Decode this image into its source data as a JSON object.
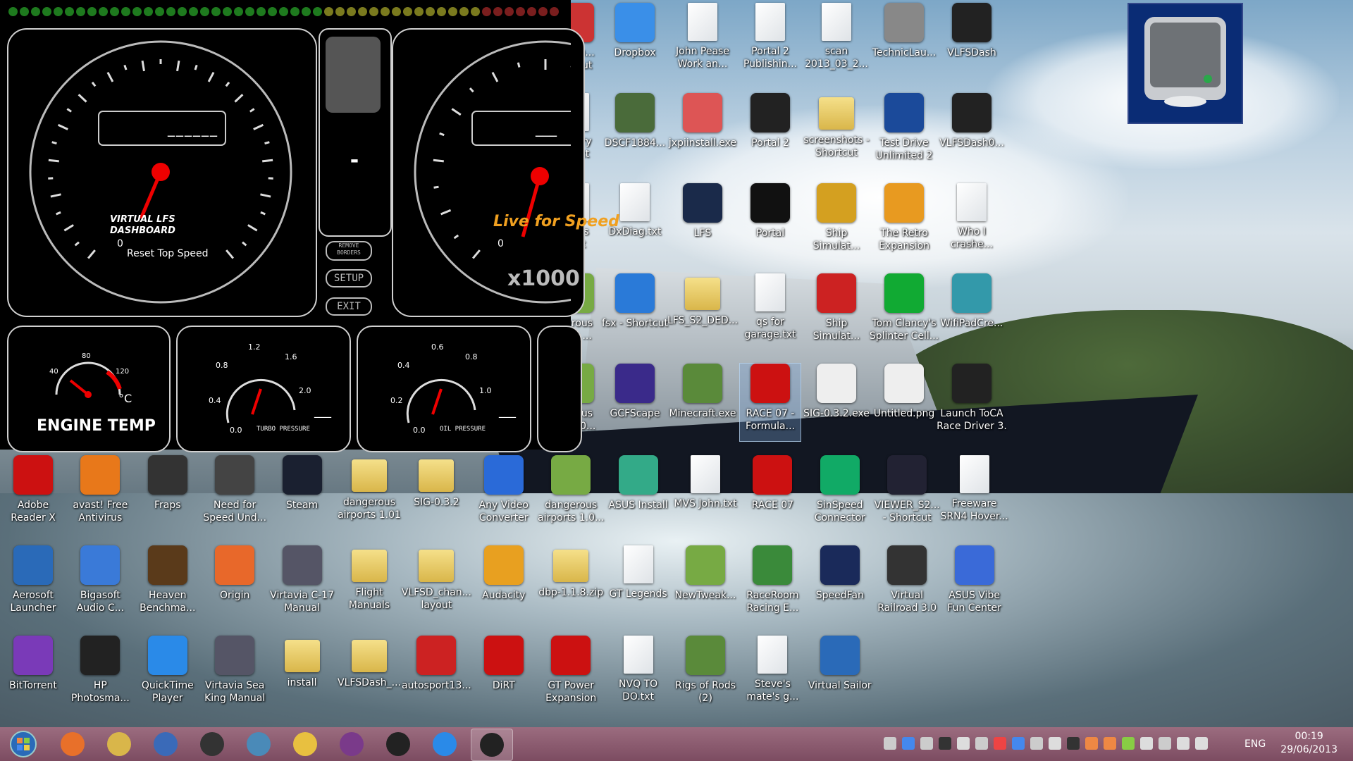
{
  "dashboard": {
    "reset_label": "Reset Top Speed",
    "logo_line1": "VIRTUAL LFS",
    "logo_line2": "DASHBOARD",
    "lfs_logo": "Live for Speed",
    "rpm_multiplier": "x1000",
    "speed_readout": "______",
    "rpm_readout": "___",
    "speed_dial_zero": "0",
    "rpm_dial_zero": "0",
    "gear": "-",
    "buttons": {
      "remove_borders": "REMOVE\nBORDERS",
      "setup": "SETUP",
      "exit": "EXIT"
    },
    "engine_temp": {
      "label": "ENGINE TEMP",
      "unit": "°C",
      "ticks": [
        "40",
        "80",
        "120"
      ]
    },
    "turbo": {
      "label": "TURBO PRESSURE",
      "ticks": [
        "0.0",
        "0.4",
        "0.8",
        "1.2",
        "1.6",
        "2.0"
      ],
      "readout": "___"
    },
    "oil": {
      "label": "OIL PRESSURE",
      "ticks": [
        "0.0",
        "0.2",
        "0.4",
        "0.6",
        "0.8",
        "1.0"
      ],
      "readout": "___"
    },
    "led_colors": [
      "#1e7a1e",
      "#7a7a1e",
      "#7a1e1e"
    ]
  },
  "desktop_icons": [
    {
      "label": "...tLau...\nhortcut",
      "icon": "shortcut-icon",
      "color": "#c33"
    },
    {
      "label": "Dropbox",
      "icon": "dropbox-icon",
      "color": "#3a8fe8"
    },
    {
      "label": "John Pease\nWork an...",
      "icon": "file-icon",
      "type": "file"
    },
    {
      "label": "Portal 2\nPublishin...",
      "icon": "file-icon",
      "type": "file"
    },
    {
      "label": "scan\n2013_03_2...",
      "icon": "scan-icon",
      "type": "file"
    },
    {
      "label": "TechnicLau...",
      "icon": "technic-icon",
      "color": "#888"
    },
    {
      "label": "VLFSDash",
      "icon": "gauge-icon",
      "color": "#222"
    },
    {
      "label": "...njury\n...t.txt",
      "icon": "file-icon",
      "type": "file"
    },
    {
      "label": "DSCF1884...",
      "icon": "photo-icon",
      "color": "#4a6b3a"
    },
    {
      "label": "jxpiinstall.exe",
      "icon": "java-icon",
      "color": "#d55"
    },
    {
      "label": "Portal 2",
      "icon": "portal2-icon",
      "color": "#222"
    },
    {
      "label": "screenshots -\nShortcut",
      "icon": "folder-icon",
      "type": "folder"
    },
    {
      "label": "Test Drive\nUnlimited 2",
      "icon": "tdu2-icon",
      "color": "#1b4a9a"
    },
    {
      "label": "VLFSDash0...",
      "icon": "gauge-icon",
      "color": "#222"
    },
    {
      "label": "...s.ns\n...txt",
      "icon": "file-icon",
      "type": "file"
    },
    {
      "label": "DxDiag.txt",
      "icon": "file-icon",
      "type": "file"
    },
    {
      "label": "LFS",
      "icon": "lfs-icon",
      "color": "#1a2a4a"
    },
    {
      "label": "Portal",
      "icon": "portal-icon",
      "color": "#111"
    },
    {
      "label": "Ship\nSimulat...",
      "icon": "ship-icon",
      "color": "#d4a020"
    },
    {
      "label": "The Retro\nExpansion",
      "icon": "retro-icon",
      "color": "#e89a20"
    },
    {
      "label": "Who I\ncrashe...",
      "icon": "file-icon",
      "type": "file"
    },
    {
      "label": "...erous\n...rts ...",
      "icon": "archive-icon",
      "color": "#7a4"
    },
    {
      "label": "fsx - Shortcut",
      "icon": "plane-icon",
      "color": "#2a7ad8"
    },
    {
      "label": "LFS_S2_DED...",
      "icon": "folder-icon",
      "type": "folder"
    },
    {
      "label": "qs for\ngarage.txt",
      "icon": "file-icon",
      "type": "file"
    },
    {
      "label": "Ship\nSimulat...",
      "icon": "ship-simulator-icon",
      "color": "#c22"
    },
    {
      "label": "Tom Clancy's\nSplinter Cell...",
      "icon": "splinter-icon",
      "color": "#1a3"
    },
    {
      "label": "WifiPadCre...",
      "icon": "gamepad-icon",
      "color": "#39a"
    },
    {
      "label": "...erous\n...s 1.0...",
      "icon": "archive-icon",
      "color": "#7a4"
    },
    {
      "label": "GCFScape",
      "icon": "gcfscape-icon",
      "color": "#3a2a8a"
    },
    {
      "label": "Minecraft.exe",
      "icon": "minecraft-icon",
      "color": "#5a8a3a"
    },
    {
      "label": "RACE 07 -\nFormula...",
      "icon": "race07-icon",
      "color": "#c11"
    },
    {
      "label": "SIG-0.3.2.exe",
      "icon": "7z-icon",
      "color": "#eee"
    },
    {
      "label": "Untitled.png",
      "icon": "image-icon",
      "color": "#eee"
    },
    {
      "label": "Launch ToCA\nRace Driver 3.",
      "icon": "toca-icon",
      "color": "#222"
    },
    {
      "label": "Adobe\nReader X",
      "icon": "adobe-icon",
      "color": "#c11"
    },
    {
      "label": "avast! Free\nAntivirus",
      "icon": "avast-icon",
      "color": "#e8781a"
    },
    {
      "label": "Fraps",
      "icon": "fraps-icon",
      "color": "#333"
    },
    {
      "label": "Need for\nSpeed Und...",
      "icon": "nfs-icon",
      "color": "#444"
    },
    {
      "label": "Steam",
      "icon": "steam-icon",
      "color": "#1a2030"
    },
    {
      "label": "dangerous\nairports 1.01",
      "icon": "folder-icon",
      "type": "folder"
    },
    {
      "label": "SIG-0.3.2",
      "icon": "folder-icon",
      "type": "folder"
    },
    {
      "label": "Any Video\nConverter",
      "icon": "video-icon",
      "color": "#2a6ad8"
    },
    {
      "label": "dangerous\nairports 1.0...",
      "icon": "archive-icon",
      "color": "#7a4"
    },
    {
      "label": "ASUS Install",
      "icon": "asus-icon",
      "color": "#3a8"
    },
    {
      "label": "MVS John.txt",
      "icon": "file-icon",
      "type": "file"
    },
    {
      "label": "RACE 07",
      "icon": "race07-icon",
      "color": "#c11"
    },
    {
      "label": "SinSpeed\nConnector",
      "icon": "sinspeed-icon",
      "color": "#1a6"
    },
    {
      "label": "VIEWER_S2...\n- Shortcut",
      "icon": "viewer-icon",
      "color": "#223"
    },
    {
      "label": "Freeware\nSRN4 Hover...",
      "icon": "file-icon",
      "type": "file"
    },
    {
      "label": "Aerosoft\nLauncher",
      "icon": "aerosoft-icon",
      "color": "#2a6ab8"
    },
    {
      "label": "Bigasoft\nAudio C...",
      "icon": "music-icon",
      "color": "#3a7ad8"
    },
    {
      "label": "Heaven\nBenchma...",
      "icon": "heaven-icon",
      "color": "#5a3a1a"
    },
    {
      "label": "Origin",
      "icon": "origin-icon",
      "color": "#e8682a"
    },
    {
      "label": "Virtavia C-17\nManual",
      "icon": "virtavia-icon",
      "color": "#556"
    },
    {
      "label": "Flight\nManuals",
      "icon": "folder-icon",
      "type": "folder"
    },
    {
      "label": "VLFSD_chan...\nlayout",
      "icon": "folder-icon",
      "type": "folder"
    },
    {
      "label": "Audacity",
      "icon": "audacity-icon",
      "color": "#e8a020"
    },
    {
      "label": "dbp-1.1.8.zip",
      "icon": "zip-icon",
      "type": "folder"
    },
    {
      "label": "GT Legends",
      "icon": "file-icon",
      "type": "file"
    },
    {
      "label": "NewTweak...",
      "icon": "archive-icon",
      "color": "#7a4"
    },
    {
      "label": "RaceRoom\nRacing E...",
      "icon": "raceroom-icon",
      "color": "#3a8a3a"
    },
    {
      "label": "SpeedFan",
      "icon": "speedfan-icon",
      "color": "#1a2a5a"
    },
    {
      "label": "Virtual\nRailroad 3.0",
      "icon": "eep-icon",
      "color": "#333"
    },
    {
      "label": "ASUS  Vibe\nFun Center",
      "icon": "vibe-icon",
      "color": "#3a6ad8"
    },
    {
      "label": "BitTorrent",
      "icon": "bittorrent-icon",
      "color": "#7a3ab8"
    },
    {
      "label": "HP\nPhotosma...",
      "icon": "printer-icon",
      "color": "#222"
    },
    {
      "label": "QuickTime\nPlayer",
      "icon": "quicktime-icon",
      "color": "#2a8ae8"
    },
    {
      "label": "Virtavia Sea\nKing Manual",
      "icon": "virtavia-icon",
      "color": "#556"
    },
    {
      "label": "install",
      "icon": "folder-icon",
      "type": "folder"
    },
    {
      "label": "VLFSDash_...",
      "icon": "folder-icon",
      "type": "folder"
    },
    {
      "label": "autosport13...",
      "icon": "pdf-icon",
      "color": "#c22"
    },
    {
      "label": "DiRT",
      "icon": "dirt-icon",
      "color": "#c11"
    },
    {
      "label": "GT Power\nExpansion",
      "icon": "gt-icon",
      "color": "#c11"
    },
    {
      "label": "NVQ TO\nDO.txt",
      "icon": "file-icon",
      "type": "file"
    },
    {
      "label": "Rigs of Rods\n(2)",
      "icon": "rigs-icon",
      "color": "#5a8a3a"
    },
    {
      "label": "Steve's\nmate's g...",
      "icon": "file-icon",
      "type": "file"
    },
    {
      "label": "Virtual Sailor",
      "icon": "sailor-icon",
      "color": "#2a6ab8"
    }
  ],
  "taskbar": {
    "items": [
      "start-orb-icon",
      "firefox-icon",
      "explorer-icon",
      "monitor-icon",
      "fraps-icon",
      "photos-icon",
      "paint-icon",
      "winrar-icon",
      "vlfsdash-icon",
      "itunes-icon",
      "vlfsdash-active-icon"
    ],
    "language": "ENG",
    "time": "00:19",
    "date": "29/06/2013"
  }
}
